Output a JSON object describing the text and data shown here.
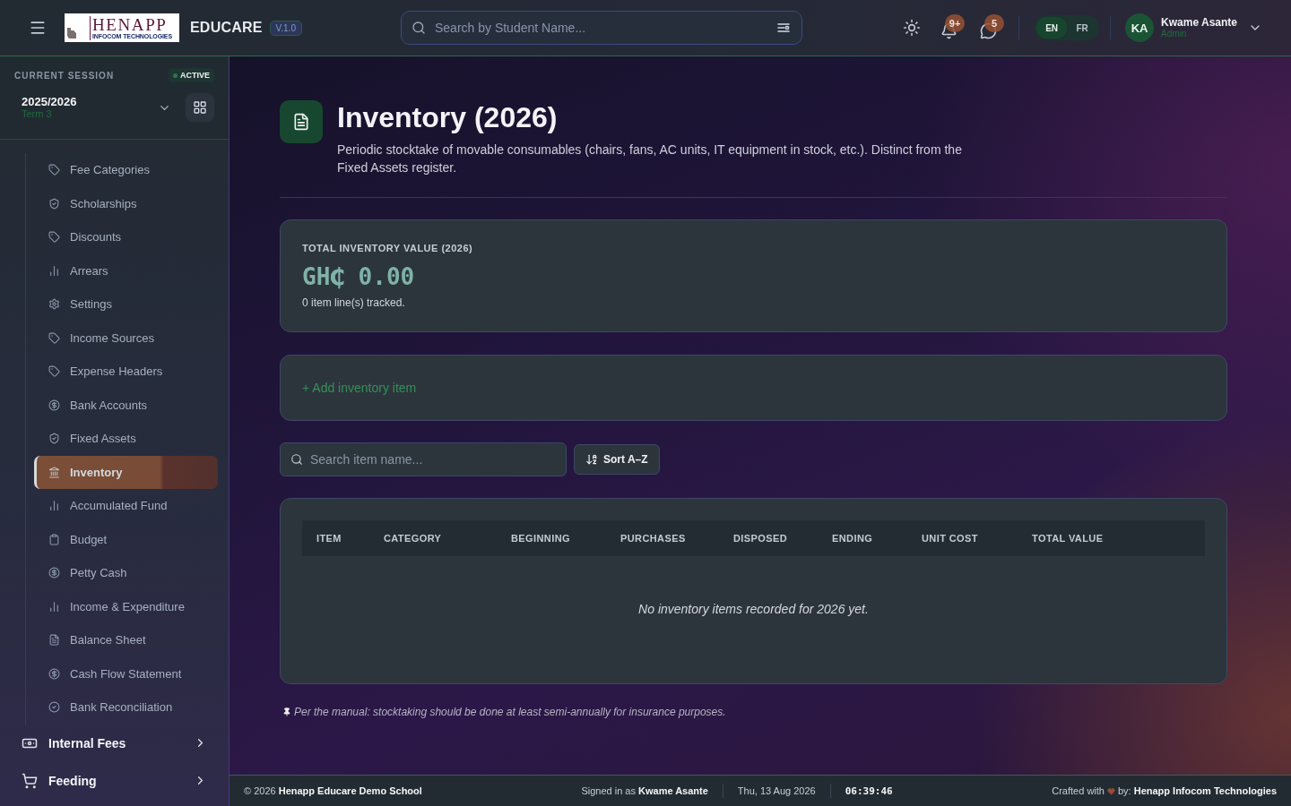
{
  "header": {
    "logo": {
      "name": "HENAPP",
      "tagline": "INFOCOM TECHNOLOGIES"
    },
    "brand": "EDUCARE",
    "version": "V.1.0",
    "search": {
      "placeholder": "Search by Student Name..."
    },
    "notifications": {
      "badge": "9+"
    },
    "messages": {
      "badge": "5"
    },
    "languages": [
      {
        "label": "EN",
        "selected": true
      },
      {
        "label": "FR",
        "selected": false
      }
    ],
    "user": {
      "initials": "KA",
      "name": "Kwame Asante",
      "role": "Admin"
    }
  },
  "sidebar": {
    "session": {
      "label": "CURRENT SESSION",
      "status": "ACTIVE",
      "year": "2025/2026",
      "term": "Term 3"
    },
    "items": [
      {
        "label": "Fee Categories",
        "selected": false
      },
      {
        "label": "Scholarships",
        "selected": false
      },
      {
        "label": "Discounts",
        "selected": false
      },
      {
        "label": "Arrears",
        "selected": false
      },
      {
        "label": "Settings",
        "selected": false
      },
      {
        "label": "Income Sources",
        "selected": false
      },
      {
        "label": "Expense Headers",
        "selected": false
      },
      {
        "label": "Bank Accounts",
        "selected": false
      },
      {
        "label": "Fixed Assets",
        "selected": false
      },
      {
        "label": "Inventory",
        "selected": true
      },
      {
        "label": "Accumulated Fund",
        "selected": false
      },
      {
        "label": "Budget",
        "selected": false
      },
      {
        "label": "Petty Cash",
        "selected": false
      },
      {
        "label": "Income & Expenditure",
        "selected": false
      },
      {
        "label": "Balance Sheet",
        "selected": false
      },
      {
        "label": "Cash Flow Statement",
        "selected": false
      },
      {
        "label": "Bank Reconciliation",
        "selected": false
      }
    ],
    "groups": [
      {
        "label": "Internal Fees",
        "expanded": false
      },
      {
        "label": "Feeding",
        "expanded": false
      }
    ]
  },
  "page": {
    "title": "Inventory (2026)",
    "description": "Periodic stocktake of movable consumables (chairs, fans, AC units, IT equipment in stock, etc.). Distinct from the Fixed Assets register.",
    "summary": {
      "label": "TOTAL INVENTORY VALUE (2026)",
      "value": "GH₵ 0.00",
      "note": "0 item line(s) tracked."
    },
    "add_link": "+ Add inventory item",
    "search": {
      "placeholder": "Search item name..."
    },
    "sort_button": "Sort A–Z",
    "table": {
      "columns": [
        "ITEM",
        "CATEGORY",
        "BEGINNING",
        "PURCHASES",
        "DISPOSED",
        "ENDING",
        "UNIT COST",
        "TOTAL VALUE"
      ],
      "empty_message": "No inventory items recorded for 2026 yet."
    },
    "footnote": "Per the manual: stocktaking should be done at least semi-annually for insurance purposes."
  },
  "status_bar": {
    "copyright": "© 2026 **Henapp Educare Demo School**",
    "signed_in": "Signed in as **Kwame Asante**",
    "date": "Thu, 13 Aug 2026",
    "time": "06:39:46",
    "crafted": "Crafted with",
    "credit": "by: **Henapp Infocom Technologies**"
  }
}
